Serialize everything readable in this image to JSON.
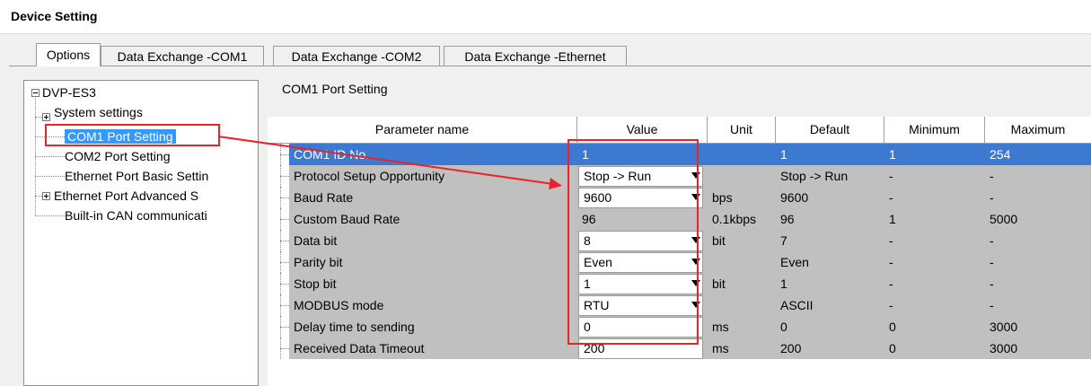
{
  "window": {
    "title": "Device Setting"
  },
  "tabs": [
    {
      "label": "Options",
      "active": true
    },
    {
      "label": "Data Exchange -COM1",
      "active": false
    },
    {
      "label": "Data Exchange -COM2",
      "active": false
    },
    {
      "label": "Data Exchange -Ethernet",
      "active": false
    }
  ],
  "tree": {
    "root": "DVP-ES3",
    "items": [
      {
        "label": "System settings",
        "expandable": true
      },
      {
        "label": "COM1 Port Setting",
        "selected": true
      },
      {
        "label": "COM2 Port Setting"
      },
      {
        "label": "Ethernet Port Basic Settin"
      },
      {
        "label": "Ethernet Port Advanced S",
        "expandable": true
      },
      {
        "label": "Built-in CAN communicati"
      }
    ]
  },
  "section": {
    "title": "COM1 Port Setting"
  },
  "grid": {
    "columns": [
      "Parameter name",
      "Value",
      "Unit",
      "Default",
      "Minimum",
      "Maximum"
    ],
    "rows": [
      {
        "name": "COM1 ID No.",
        "value": "1",
        "unit": "",
        "default": "1",
        "min": "1",
        "max": "254",
        "selected": true,
        "editable": false,
        "dropdown": false
      },
      {
        "name": "Protocol Setup Opportunity",
        "value": "Stop -> Run",
        "unit": "",
        "default": "Stop -> Run",
        "min": "-",
        "max": "-",
        "editable": true,
        "dropdown": true
      },
      {
        "name": "Baud Rate",
        "value": "9600",
        "unit": "bps",
        "default": "9600",
        "min": "-",
        "max": "-",
        "editable": true,
        "dropdown": true
      },
      {
        "name": "Custom Baud Rate",
        "value": "96",
        "unit": "0.1kbps",
        "default": "96",
        "min": "1",
        "max": "5000",
        "editable": false,
        "dropdown": false
      },
      {
        "name": "Data bit",
        "value": "8",
        "unit": "bit",
        "default": "7",
        "min": "-",
        "max": "-",
        "editable": true,
        "dropdown": true
      },
      {
        "name": "Parity bit",
        "value": "Even",
        "unit": "",
        "default": "Even",
        "min": "-",
        "max": "-",
        "editable": true,
        "dropdown": true
      },
      {
        "name": "Stop bit",
        "value": "1",
        "unit": "bit",
        "default": "1",
        "min": "-",
        "max": "-",
        "editable": true,
        "dropdown": true
      },
      {
        "name": "MODBUS mode",
        "value": "RTU",
        "unit": "",
        "default": "ASCII",
        "min": "-",
        "max": "-",
        "editable": true,
        "dropdown": true
      },
      {
        "name": "Delay time to sending",
        "value": "0",
        "unit": "ms",
        "default": "0",
        "min": "0",
        "max": "3000",
        "editable": true,
        "dropdown": false
      },
      {
        "name": "Received Data Timeout",
        "value": "200",
        "unit": "ms",
        "default": "200",
        "min": "0",
        "max": "3000",
        "editable": true,
        "dropdown": false
      }
    ]
  },
  "colors": {
    "selection": "#3d79d1",
    "highlight": "#e8242b",
    "readonly_row": "#c0c0c0"
  }
}
